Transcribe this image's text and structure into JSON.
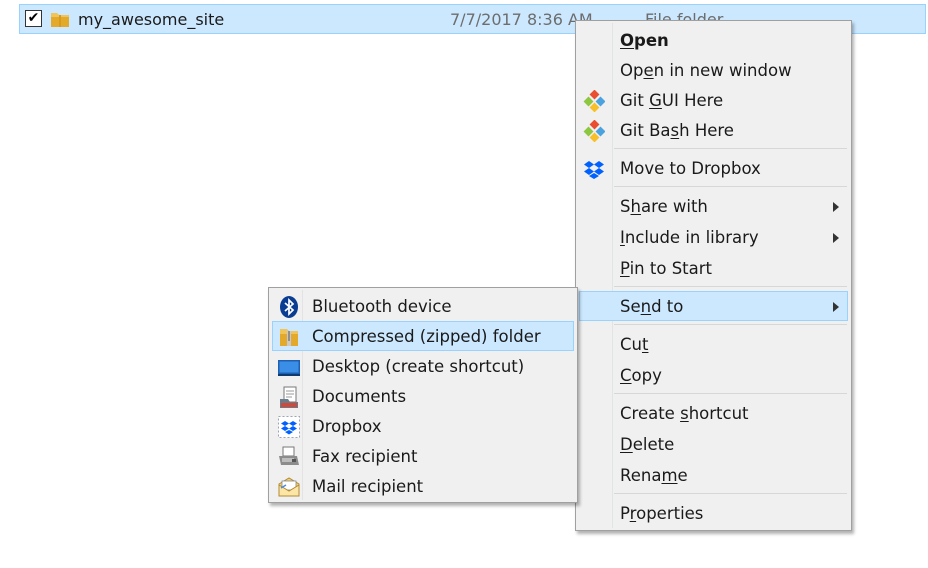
{
  "file": {
    "checked_mark": "✔",
    "name": "my_awesome_site",
    "date": "7/7/2017 8:36 AM",
    "type": "File folder"
  },
  "context_menu": {
    "items": [
      {
        "pre": "",
        "key": "O",
        "post": "pen"
      },
      {
        "pre": "Op",
        "key": "e",
        "post": "n in new window"
      },
      {
        "pre": "Git ",
        "key": "G",
        "post": "UI Here"
      },
      {
        "pre": "Git Ba",
        "key": "s",
        "post": "h Here"
      },
      {
        "pre": "Move to Dropbox",
        "key": "",
        "post": ""
      },
      {
        "pre": "S",
        "key": "h",
        "post": "are with"
      },
      {
        "pre": "",
        "key": "I",
        "post": "nclude in library"
      },
      {
        "pre": "",
        "key": "P",
        "post": "in to Start"
      },
      {
        "pre": "Se",
        "key": "n",
        "post": "d to"
      },
      {
        "pre": "Cu",
        "key": "t",
        "post": ""
      },
      {
        "pre": "",
        "key": "C",
        "post": "opy"
      },
      {
        "pre": "Create ",
        "key": "s",
        "post": "hortcut"
      },
      {
        "pre": "",
        "key": "D",
        "post": "elete"
      },
      {
        "pre": "Rena",
        "key": "m",
        "post": "e"
      },
      {
        "pre": "P",
        "key": "r",
        "post": "operties"
      }
    ]
  },
  "send_to_menu": {
    "items": [
      {
        "label": "Bluetooth device"
      },
      {
        "label": "Compressed (zipped) folder"
      },
      {
        "label": "Desktop (create shortcut)"
      },
      {
        "label": "Documents"
      },
      {
        "label": "Dropbox"
      },
      {
        "label": "Fax recipient"
      },
      {
        "label": "Mail recipient"
      }
    ]
  },
  "colors": {
    "selection_fill": "#cce8ff",
    "selection_border": "#99d1ff",
    "menu_background": "#f0f0f0",
    "bluetooth": "#0a3d91",
    "dropbox": "#0061fe",
    "folder": "#f0c458"
  }
}
